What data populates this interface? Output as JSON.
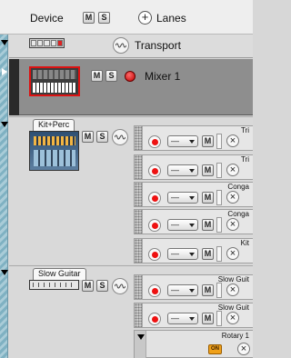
{
  "header": {
    "device_label": "Device",
    "m_label": "M",
    "s_label": "S",
    "add_symbol": "+",
    "lanes_label": "Lanes"
  },
  "transport": {
    "label": "Transport"
  },
  "mixer": {
    "label": "Mixer 1"
  },
  "groups": [
    {
      "tab": "Kit+Perc",
      "tracks": [
        {
          "name": "Tri",
          "value": "—"
        },
        {
          "name": "Tri",
          "value": "—"
        },
        {
          "name": "Conga",
          "value": "—"
        },
        {
          "name": "Conga",
          "value": "—"
        },
        {
          "name": "Kit",
          "value": "—"
        }
      ]
    },
    {
      "tab": "Slow Guitar",
      "tracks": [
        {
          "name": "Slow Guit",
          "value": "—"
        },
        {
          "name": "Slow Guit",
          "value": "—"
        }
      ],
      "rotary": {
        "label": "Rotary 1",
        "on_label": "ON"
      }
    }
  ],
  "common": {
    "m": "M",
    "s": "S",
    "x": "×"
  },
  "colors": {
    "record": "#e11111",
    "stripe": "#7fb1c2",
    "on_button": "#f0a11a",
    "mixer_selected": "#8e8e8e"
  }
}
